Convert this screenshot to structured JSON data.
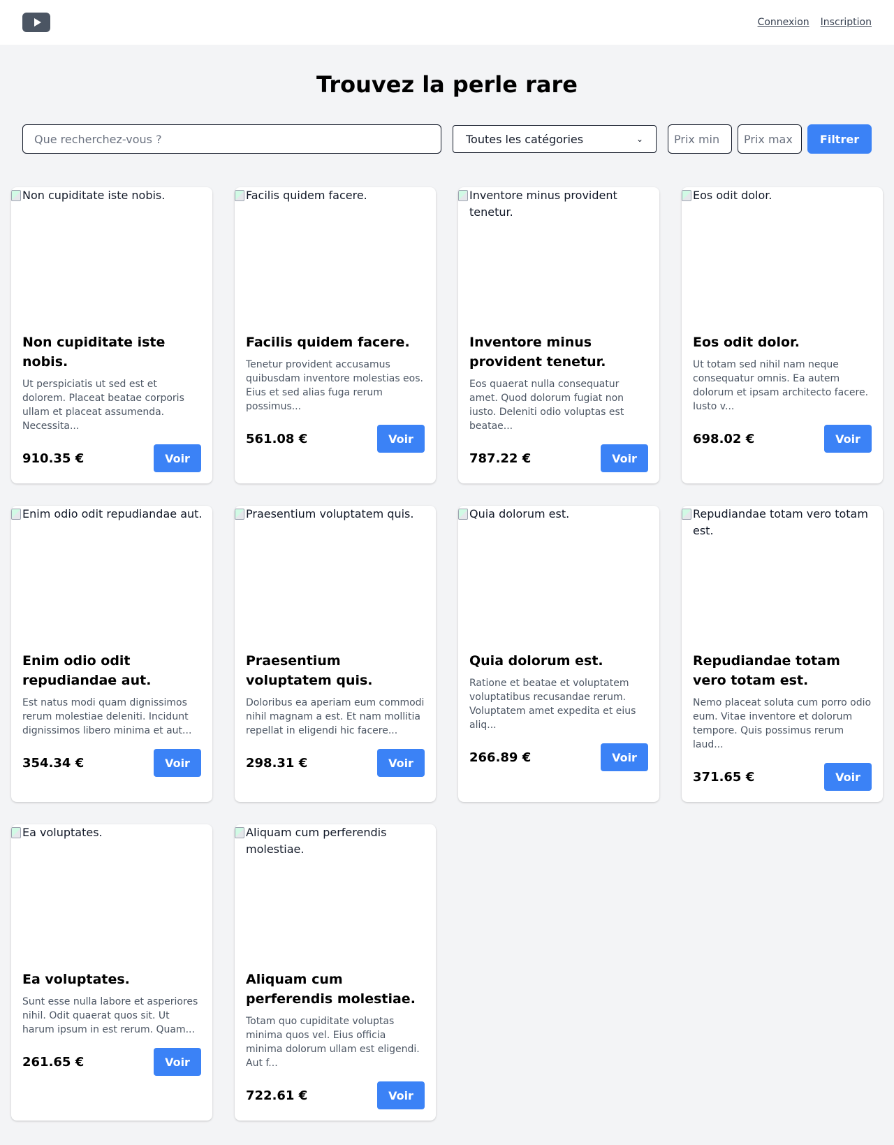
{
  "header": {
    "logo_icon": "play-icon",
    "login_label": "Connexion",
    "register_label": "Inscription"
  },
  "hero": {
    "title": "Trouvez la perle rare"
  },
  "filters": {
    "search_placeholder": "Que recherchez-vous ?",
    "category_selected": "Toutes les catégories",
    "price_min_placeholder": "Prix min",
    "price_max_placeholder": "Prix max",
    "filter_label": "Filtrer"
  },
  "colors": {
    "accent": "#3b82f6",
    "background": "#f3f4f6",
    "logo": "#4b5563"
  },
  "products": [
    {
      "image_alt": "Non cupiditate iste nobis.",
      "title": "Non cupiditate iste nobis.",
      "description": "Ut perspiciatis ut sed est et dolorem. Placeat beatae corporis ullam et placeat assumenda. Necessita...",
      "price": "910.35 €",
      "button": "Voir"
    },
    {
      "image_alt": "Facilis quidem facere.",
      "title": "Facilis quidem facere.",
      "description": "Tenetur provident accusamus quibusdam inventore molestias eos. Eius et sed alias fuga rerum possimus...",
      "price": "561.08 €",
      "button": "Voir"
    },
    {
      "image_alt": "Inventore minus provident tenetur.",
      "title": "Inventore minus provident tenetur.",
      "description": "Eos quaerat nulla consequatur amet. Quod dolorum fugiat non iusto. Deleniti odio voluptas est beatae...",
      "price": "787.22 €",
      "button": "Voir"
    },
    {
      "image_alt": "Eos odit dolor.",
      "title": "Eos odit dolor.",
      "description": "Ut totam sed nihil nam neque consequatur omnis. Ea autem dolorum et ipsam architecto facere. Iusto v...",
      "price": "698.02 €",
      "button": "Voir"
    },
    {
      "image_alt": "Enim odio odit repudiandae aut.",
      "title": "Enim odio odit repudiandae aut.",
      "description": "Est natus modi quam dignissimos rerum molestiae deleniti. Incidunt dignissimos libero minima et aut...",
      "price": "354.34 €",
      "button": "Voir"
    },
    {
      "image_alt": "Praesentium voluptatem quis.",
      "title": "Praesentium voluptatem quis.",
      "description": "Doloribus ea aperiam eum commodi nihil magnam a est. Et nam mollitia repellat in eligendi hic facere...",
      "price": "298.31 €",
      "button": "Voir"
    },
    {
      "image_alt": "Quia dolorum est.",
      "title": "Quia dolorum est.",
      "description": "Ratione et beatae et voluptatem voluptatibus recusandae rerum. Voluptatem amet expedita et eius aliq...",
      "price": "266.89 €",
      "button": "Voir"
    },
    {
      "image_alt": "Repudiandae totam vero totam est.",
      "title": "Repudiandae totam vero totam est.",
      "description": "Nemo placeat soluta cum porro odio eum. Vitae inventore et dolorum tempore. Quis possimus rerum laud...",
      "price": "371.65 €",
      "button": "Voir"
    },
    {
      "image_alt": "Ea voluptates.",
      "title": "Ea voluptates.",
      "description": "Sunt esse nulla labore et asperiores nihil. Odit quaerat quos sit. Ut harum ipsum in est rerum. Quam...",
      "price": "261.65 €",
      "button": "Voir"
    },
    {
      "image_alt": "Aliquam cum perferendis molestiae.",
      "title": "Aliquam cum perferendis molestiae.",
      "description": "Totam quo cupiditate voluptas minima quos vel. Eius officia minima dolorum ullam est eligendi. Aut f...",
      "price": "722.61 €",
      "button": "Voir"
    }
  ]
}
